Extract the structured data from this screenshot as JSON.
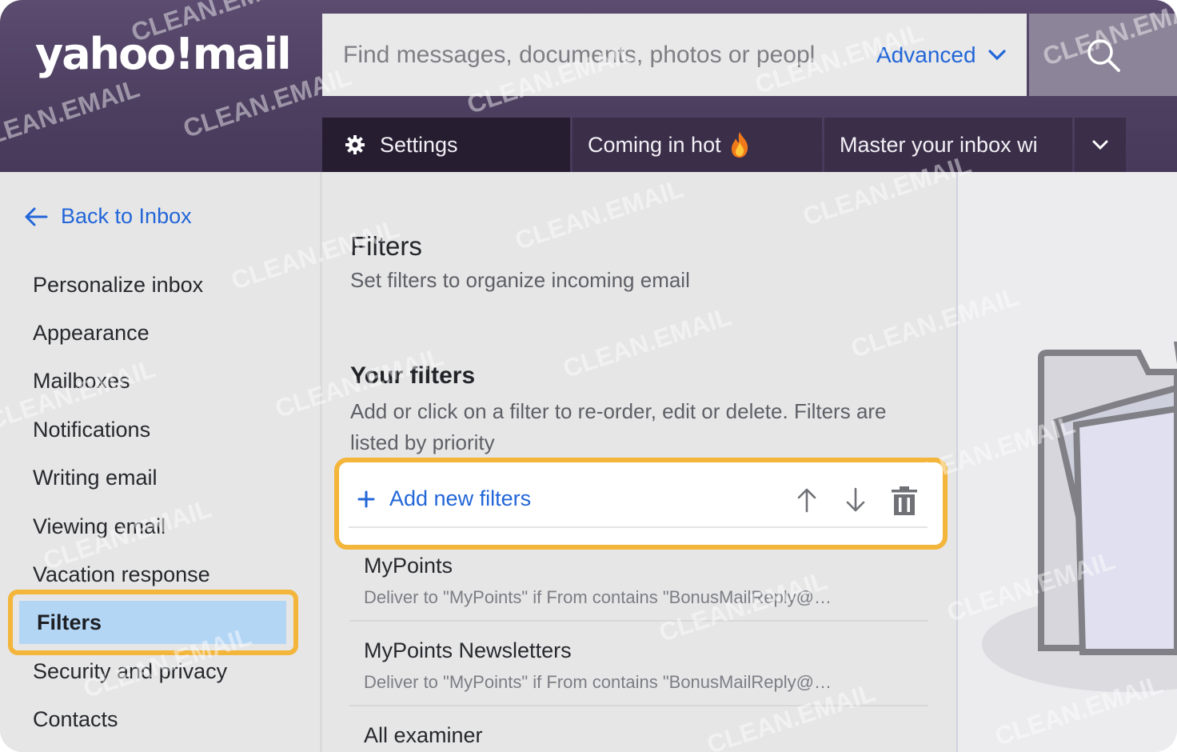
{
  "header": {
    "logo": "yahoo!mail",
    "search": {
      "placeholder": "Find messages, documents, photos or peopl",
      "advanced_label": "Advanced"
    },
    "tabs": [
      {
        "label": "Settings",
        "icon": "gear-icon"
      },
      {
        "label": "Coming in hot",
        "icon": "fire-icon"
      },
      {
        "label": "Master your inbox wi"
      }
    ]
  },
  "sidebar": {
    "back_label": "Back to Inbox",
    "items": [
      {
        "label": "Personalize inbox"
      },
      {
        "label": "Appearance"
      },
      {
        "label": "Mailboxes"
      },
      {
        "label": "Notifications"
      },
      {
        "label": "Writing email"
      },
      {
        "label": "Viewing email"
      },
      {
        "label": "Vacation response"
      },
      {
        "label": "Filters",
        "selected": true
      },
      {
        "label": "Security and privacy"
      },
      {
        "label": "Contacts"
      }
    ]
  },
  "main": {
    "title": "Filters",
    "subtitle": "Set filters to organize incoming email",
    "your_filters_title": "Your filters",
    "your_filters_desc": "Add or click on a filter to re-order, edit or delete. Filters are listed by priority",
    "add_label": "Add new filters",
    "filters": [
      {
        "name": "MyPoints",
        "desc": "Deliver to \"MyPoints\" if From contains \"BonusMailReply@…"
      },
      {
        "name": "MyPoints Newsletters",
        "desc": "Deliver to \"MyPoints\" if From contains \"BonusMailReply@…"
      },
      {
        "name": "All examiner",
        "desc": ""
      }
    ]
  },
  "watermark": "CLEAN.EMAIL",
  "colors": {
    "header_bg": "#4d3f60",
    "accent_link": "#2266d8",
    "highlight": "#f3b53a",
    "selected_bg": "#b4d6f5"
  }
}
